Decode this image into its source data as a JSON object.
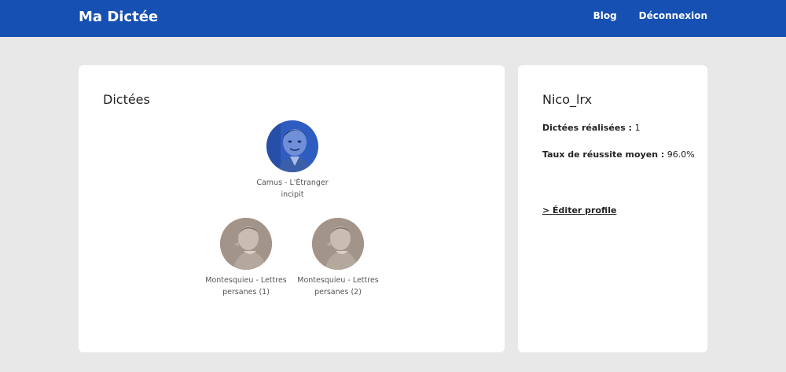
{
  "app": {
    "brand": "Ma Dictée"
  },
  "nav": {
    "blog": "Blog",
    "logout": "Déconnexion"
  },
  "dictees": {
    "title": "Dictées",
    "items": [
      {
        "label": "Camus - L'Étranger incipit",
        "icon": "camus-portrait"
      },
      {
        "label": "Montesquieu - Lettres persanes (1)",
        "icon": "montesquieu-portrait"
      },
      {
        "label": "Montesquieu - Lettres persanes (2)",
        "icon": "montesquieu-portrait"
      }
    ]
  },
  "profile": {
    "username": "Nico_lrx",
    "done_label": "Dictées réalisées :",
    "done_value": "1",
    "rate_label": "Taux de réussite moyen :",
    "rate_value": "96.0%",
    "edit_label": "> Éditer profile"
  },
  "colors": {
    "navbar": "#1650b3",
    "background": "#e8e8e8",
    "camus_tint": "#2f5cc0",
    "montesquieu_tint": "#9a8a80"
  }
}
